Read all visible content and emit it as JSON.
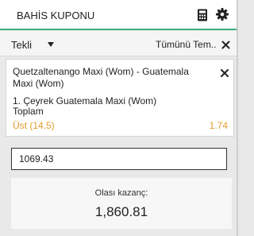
{
  "header": {
    "title": "BAHİS KUPONU",
    "icons": [
      "calculator-icon",
      "gear-icon"
    ]
  },
  "bet_type": {
    "selected": "Tekli",
    "remove_all_label": "Tümünü Tem..."
  },
  "selection": {
    "match": "Quetzaltenango Maxi (Wom) - Guatemala Maxi (Wom)",
    "market_line1": "1. Çeyrek Guatemala Maxi (Wom)",
    "market_line2": "Toplam",
    "pick": "Üst (14.5)",
    "odds": "1.74"
  },
  "stake": {
    "value": "1069.43"
  },
  "winnings": {
    "label": "Olası kazanç:",
    "amount": "1,860.81"
  },
  "colors": {
    "accent": "#3fb07a",
    "odds": "#e39b2c"
  }
}
